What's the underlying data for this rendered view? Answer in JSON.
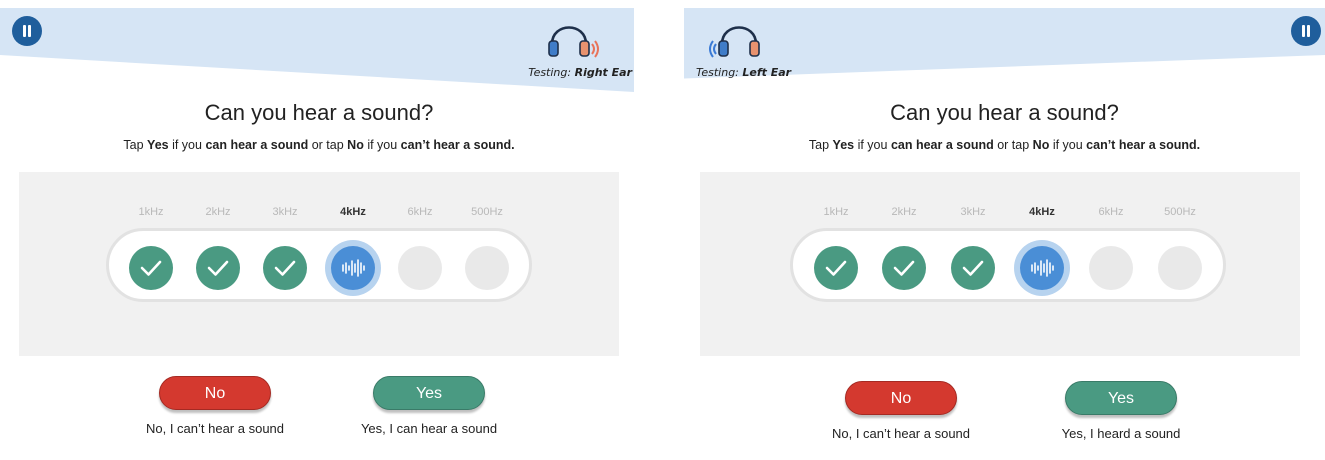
{
  "colors": {
    "banner": "#d6e5f5",
    "pause_button": "#1f5e9c",
    "done_step": "#4a9a82",
    "current_step": "#4a8ed6",
    "pending_step": "#e9e9e9",
    "no_button": "#d4392f",
    "yes_button": "#4a9a82",
    "right_ear_waves": "#e8735a",
    "left_ear_waves": "#3b7bd6"
  },
  "left_screen": {
    "testing_prefix": "Testing:",
    "testing_ear": "Right Ear",
    "question": "Can you hear a sound?",
    "instruction": {
      "p1": "Tap ",
      "b1": "Yes",
      "p2": " if you ",
      "b2": "can hear a sound",
      "p3": " or tap ",
      "b3": "No",
      "p4": " if you ",
      "b4": "can’t hear a sound."
    },
    "frequencies": [
      {
        "label": "1kHz",
        "status": "done"
      },
      {
        "label": "2kHz",
        "status": "done"
      },
      {
        "label": "3kHz",
        "status": "done"
      },
      {
        "label": "4kHz",
        "status": "current"
      },
      {
        "label": "6kHz",
        "status": "pending"
      },
      {
        "label": "500Hz",
        "status": "pending"
      }
    ],
    "no_label": "No",
    "no_caption": "No, I can’t hear a sound",
    "yes_label": "Yes",
    "yes_caption": "Yes, I can hear a sound"
  },
  "right_screen": {
    "testing_prefix": "Testing:",
    "testing_ear": "Left Ear",
    "question": "Can you hear a sound?",
    "instruction": {
      "p1": "Tap ",
      "b1": "Yes",
      "p2": " if you ",
      "b2": "can hear a sound",
      "p3": " or tap ",
      "b3": "No",
      "p4": " if you ",
      "b4": "can’t hear a sound."
    },
    "frequencies": [
      {
        "label": "1kHz",
        "status": "done"
      },
      {
        "label": "2kHz",
        "status": "done"
      },
      {
        "label": "3kHz",
        "status": "done"
      },
      {
        "label": "4kHz",
        "status": "current"
      },
      {
        "label": "6kHz",
        "status": "pending"
      },
      {
        "label": "500Hz",
        "status": "pending"
      }
    ],
    "no_label": "No",
    "no_caption": "No, I can’t hear a sound",
    "yes_label": "Yes",
    "yes_caption": "Yes, I heard a sound"
  }
}
